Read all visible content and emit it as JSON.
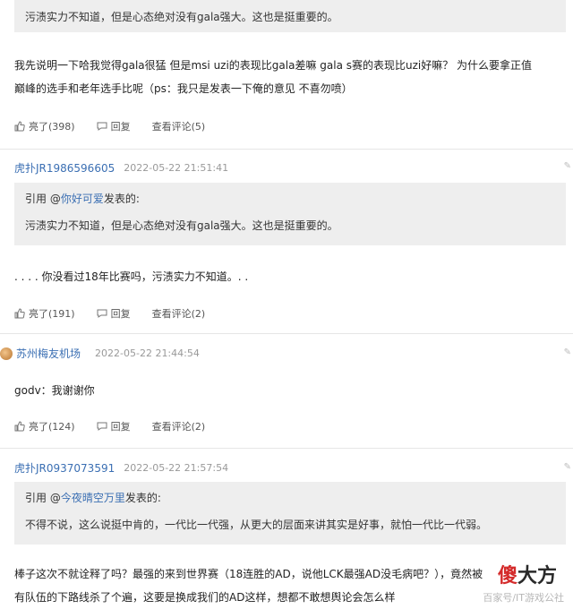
{
  "comments": [
    {
      "quote_text": "污渍实力不知道，但是心态绝对没有gala强大。这也是挺重要的。",
      "body_lines": [
        "我先说明一下哈我觉得gala很猛 但是msi uzi的表现比gala差嘛 gala s赛的表现比uzi好嘛？ 为什么要拿正值",
        "巅峰的选手和老年选手比呢（ps：我只是发表一下俺的意见 不喜勿喷）"
      ],
      "like_label": "亮了(398)",
      "reply_label": "回复",
      "view_label": "查看评论(5)"
    },
    {
      "username": "虎扑JR1986596605",
      "time": "2022-05-22 21:51:41",
      "quote_prefix": "引用 @",
      "quote_user": "你好可爱",
      "quote_suffix": "发表的:",
      "quote_text": "污渍实力不知道，但是心态绝对没有gala强大。这也是挺重要的。",
      "body": ". . . .  你没看过18年比赛吗，污渍实力不知道。. .",
      "like_label": "亮了(191)",
      "reply_label": "回复",
      "view_label": "查看评论(2)"
    },
    {
      "username": "苏州梅友机场",
      "time": "2022-05-22 21:44:54",
      "body": "godv：我谢谢你",
      "like_label": "亮了(124)",
      "reply_label": "回复",
      "view_label": "查看评论(2)"
    },
    {
      "username": "虎扑JR0937073591",
      "time": "2022-05-22 21:57:54",
      "quote_prefix": "引用 @",
      "quote_user": "今夜晴空万里",
      "quote_suffix": "发表的:",
      "quote_text": "不得不说，这么说挺中肯的，一代比一代强，从更大的层面来讲其实是好事，就怕一代比一代弱。",
      "body_lines": [
        "棒子这次不就诠释了吗？最强的来到世界赛（18连胜的AD，说他LCK最强AD没毛病吧？），竟然被",
        "有队伍的下路线杀了个遍，这要是换成我们的AD这样，想都不敢想舆论会怎么样"
      ]
    }
  ],
  "watermark": {
    "part1": "傻",
    "part2": "大方",
    "sub": "百家号/IT游戏公社"
  },
  "edge_icon": "✎"
}
